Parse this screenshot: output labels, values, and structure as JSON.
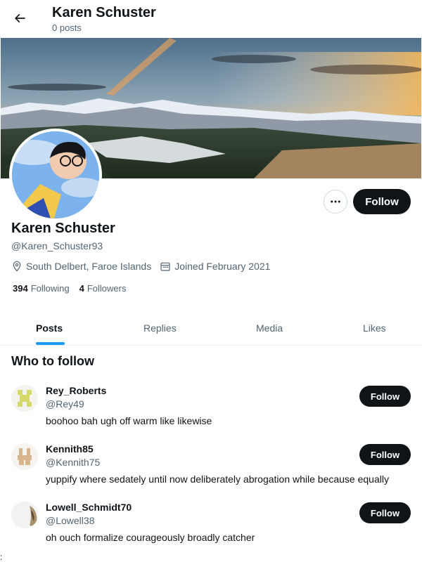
{
  "header": {
    "title": "Karen Schuster",
    "posts_count": "0 posts",
    "back_icon": "arrow-left-icon"
  },
  "profile": {
    "display_name": "Karen Schuster",
    "handle": "@Karen_Schuster93",
    "location": "South Delbert, Faroe Islands",
    "joined": "Joined February 2021",
    "following_count": "394",
    "following_label": "Following",
    "followers_count": "4",
    "followers_label": "Followers",
    "follow_label": "Follow",
    "more_icon": "more-horizontal-icon"
  },
  "tabs": [
    {
      "label": "Posts",
      "active": true
    },
    {
      "label": "Replies",
      "active": false
    },
    {
      "label": "Media",
      "active": false
    },
    {
      "label": "Likes",
      "active": false
    }
  ],
  "who_to_follow": {
    "title": "Who to follow",
    "items": [
      {
        "name": "Rey_Roberts",
        "handle": "@Rey49",
        "bio": "boohoo bah ugh off warm like likewise",
        "follow_label": "Follow"
      },
      {
        "name": "Kennith85",
        "handle": "@Kennith75",
        "bio": "yuppify where sedately until now deliberately abrogation while because equally",
        "follow_label": "Follow"
      },
      {
        "name": "Lowell_Schmidt70",
        "handle": "@Lowell38",
        "bio": "oh ouch formalize courageously broadly catcher",
        "follow_label": "Follow"
      }
    ]
  },
  "colors": {
    "accent": "#1d9bf0",
    "button_dark": "#0f1419",
    "secondary_text": "#536471"
  },
  "stray_text": ":"
}
